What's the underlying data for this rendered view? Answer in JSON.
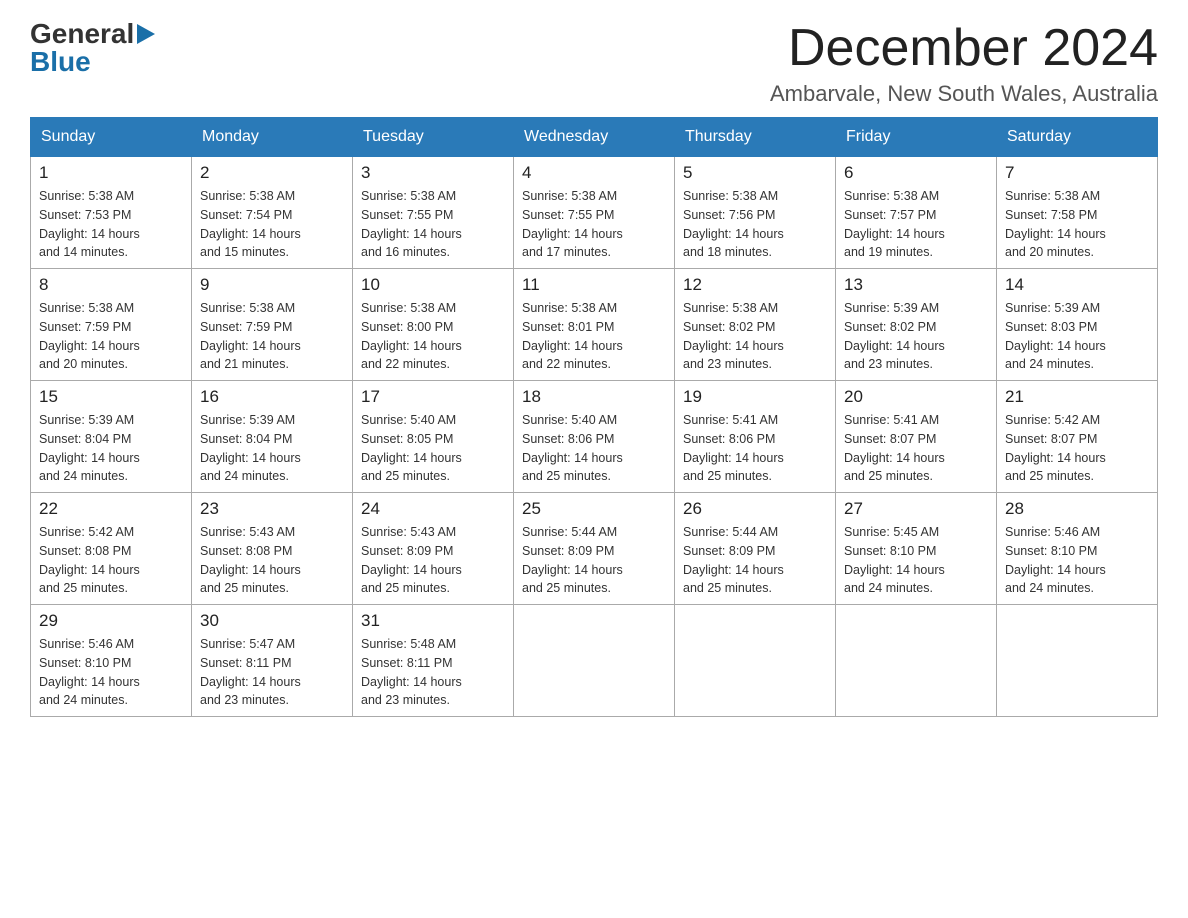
{
  "header": {
    "logo_general": "General",
    "logo_blue": "Blue",
    "month_title": "December 2024",
    "location": "Ambarvale, New South Wales, Australia"
  },
  "weekdays": [
    "Sunday",
    "Monday",
    "Tuesday",
    "Wednesday",
    "Thursday",
    "Friday",
    "Saturday"
  ],
  "weeks": [
    [
      {
        "day": "1",
        "sunrise": "5:38 AM",
        "sunset": "7:53 PM",
        "daylight": "14 hours and 14 minutes."
      },
      {
        "day": "2",
        "sunrise": "5:38 AM",
        "sunset": "7:54 PM",
        "daylight": "14 hours and 15 minutes."
      },
      {
        "day": "3",
        "sunrise": "5:38 AM",
        "sunset": "7:55 PM",
        "daylight": "14 hours and 16 minutes."
      },
      {
        "day": "4",
        "sunrise": "5:38 AM",
        "sunset": "7:55 PM",
        "daylight": "14 hours and 17 minutes."
      },
      {
        "day": "5",
        "sunrise": "5:38 AM",
        "sunset": "7:56 PM",
        "daylight": "14 hours and 18 minutes."
      },
      {
        "day": "6",
        "sunrise": "5:38 AM",
        "sunset": "7:57 PM",
        "daylight": "14 hours and 19 minutes."
      },
      {
        "day": "7",
        "sunrise": "5:38 AM",
        "sunset": "7:58 PM",
        "daylight": "14 hours and 20 minutes."
      }
    ],
    [
      {
        "day": "8",
        "sunrise": "5:38 AM",
        "sunset": "7:59 PM",
        "daylight": "14 hours and 20 minutes."
      },
      {
        "day": "9",
        "sunrise": "5:38 AM",
        "sunset": "7:59 PM",
        "daylight": "14 hours and 21 minutes."
      },
      {
        "day": "10",
        "sunrise": "5:38 AM",
        "sunset": "8:00 PM",
        "daylight": "14 hours and 22 minutes."
      },
      {
        "day": "11",
        "sunrise": "5:38 AM",
        "sunset": "8:01 PM",
        "daylight": "14 hours and 22 minutes."
      },
      {
        "day": "12",
        "sunrise": "5:38 AM",
        "sunset": "8:02 PM",
        "daylight": "14 hours and 23 minutes."
      },
      {
        "day": "13",
        "sunrise": "5:39 AM",
        "sunset": "8:02 PM",
        "daylight": "14 hours and 23 minutes."
      },
      {
        "day": "14",
        "sunrise": "5:39 AM",
        "sunset": "8:03 PM",
        "daylight": "14 hours and 24 minutes."
      }
    ],
    [
      {
        "day": "15",
        "sunrise": "5:39 AM",
        "sunset": "8:04 PM",
        "daylight": "14 hours and 24 minutes."
      },
      {
        "day": "16",
        "sunrise": "5:39 AM",
        "sunset": "8:04 PM",
        "daylight": "14 hours and 24 minutes."
      },
      {
        "day": "17",
        "sunrise": "5:40 AM",
        "sunset": "8:05 PM",
        "daylight": "14 hours and 25 minutes."
      },
      {
        "day": "18",
        "sunrise": "5:40 AM",
        "sunset": "8:06 PM",
        "daylight": "14 hours and 25 minutes."
      },
      {
        "day": "19",
        "sunrise": "5:41 AM",
        "sunset": "8:06 PM",
        "daylight": "14 hours and 25 minutes."
      },
      {
        "day": "20",
        "sunrise": "5:41 AM",
        "sunset": "8:07 PM",
        "daylight": "14 hours and 25 minutes."
      },
      {
        "day": "21",
        "sunrise": "5:42 AM",
        "sunset": "8:07 PM",
        "daylight": "14 hours and 25 minutes."
      }
    ],
    [
      {
        "day": "22",
        "sunrise": "5:42 AM",
        "sunset": "8:08 PM",
        "daylight": "14 hours and 25 minutes."
      },
      {
        "day": "23",
        "sunrise": "5:43 AM",
        "sunset": "8:08 PM",
        "daylight": "14 hours and 25 minutes."
      },
      {
        "day": "24",
        "sunrise": "5:43 AM",
        "sunset": "8:09 PM",
        "daylight": "14 hours and 25 minutes."
      },
      {
        "day": "25",
        "sunrise": "5:44 AM",
        "sunset": "8:09 PM",
        "daylight": "14 hours and 25 minutes."
      },
      {
        "day": "26",
        "sunrise": "5:44 AM",
        "sunset": "8:09 PM",
        "daylight": "14 hours and 25 minutes."
      },
      {
        "day": "27",
        "sunrise": "5:45 AM",
        "sunset": "8:10 PM",
        "daylight": "14 hours and 24 minutes."
      },
      {
        "day": "28",
        "sunrise": "5:46 AM",
        "sunset": "8:10 PM",
        "daylight": "14 hours and 24 minutes."
      }
    ],
    [
      {
        "day": "29",
        "sunrise": "5:46 AM",
        "sunset": "8:10 PM",
        "daylight": "14 hours and 24 minutes."
      },
      {
        "day": "30",
        "sunrise": "5:47 AM",
        "sunset": "8:11 PM",
        "daylight": "14 hours and 23 minutes."
      },
      {
        "day": "31",
        "sunrise": "5:48 AM",
        "sunset": "8:11 PM",
        "daylight": "14 hours and 23 minutes."
      },
      null,
      null,
      null,
      null
    ]
  ],
  "labels": {
    "sunrise": "Sunrise:",
    "sunset": "Sunset:",
    "daylight": "Daylight:"
  }
}
